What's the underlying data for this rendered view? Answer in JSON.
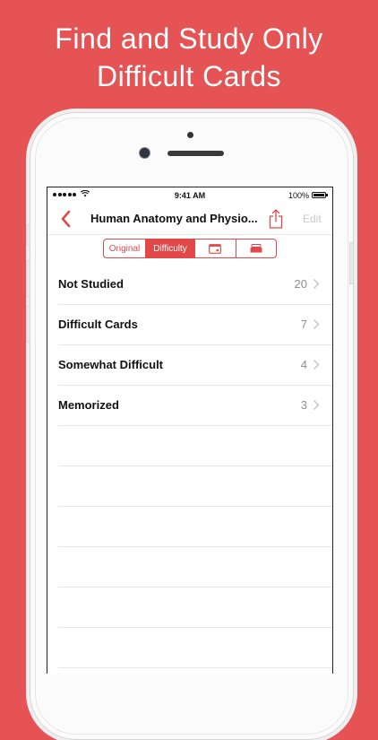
{
  "headline": {
    "line1": "Find and Study Only",
    "line2": "Difficult Cards"
  },
  "status_bar": {
    "time": "9:41 AM",
    "battery": "100%"
  },
  "nav": {
    "title": "Human Anatomy and Physio...",
    "edit_label": "Edit"
  },
  "segments": [
    {
      "label": "Original",
      "active": false
    },
    {
      "label": "Difficulty",
      "active": true
    },
    {
      "icon": "calendar-icon",
      "active": false
    },
    {
      "icon": "card-stack-icon",
      "active": false
    }
  ],
  "rows": [
    {
      "label": "Not Studied",
      "count": "20"
    },
    {
      "label": "Difficult Cards",
      "count": "7"
    },
    {
      "label": "Somewhat Difficult",
      "count": "4"
    },
    {
      "label": "Memorized",
      "count": "3"
    }
  ],
  "colors": {
    "background": "#e65354",
    "accent": "#e0484a",
    "muted": "#8e8e93"
  }
}
